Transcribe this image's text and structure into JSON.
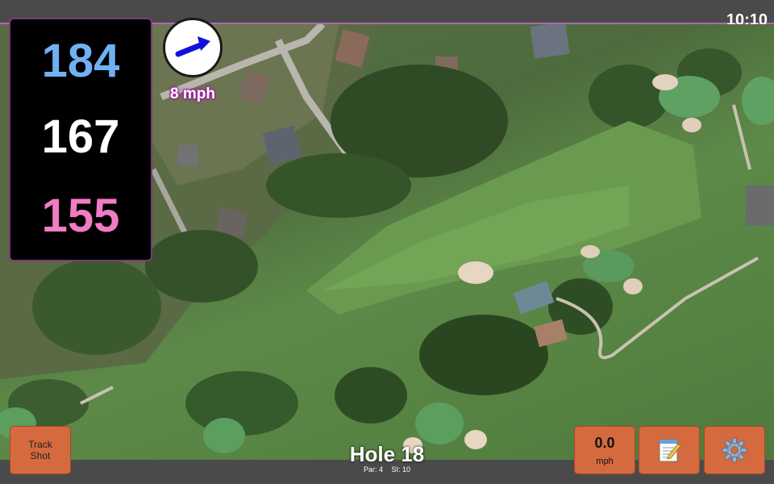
{
  "status": {
    "time": "10:10"
  },
  "distances": {
    "back": "184",
    "middle": "167",
    "front": "155",
    "colors": {
      "back": "#6fb1f2",
      "middle": "#ffffff",
      "front": "#f07cc4"
    }
  },
  "wind": {
    "speed": "8 mph",
    "direction_icon": "arrow-up-right-icon",
    "arrow_color": "#1111dd"
  },
  "buttons": {
    "track_shot_line1": "Track",
    "track_shot_line2": "Shot",
    "speed_value": "0.0",
    "speed_unit": "mph",
    "notes_icon": "notepad-icon",
    "settings_icon": "gear-icon",
    "accent": "#d46a3e"
  },
  "hole": {
    "title": "Hole 18",
    "par": "Par: 4",
    "si": "SI: 10"
  }
}
